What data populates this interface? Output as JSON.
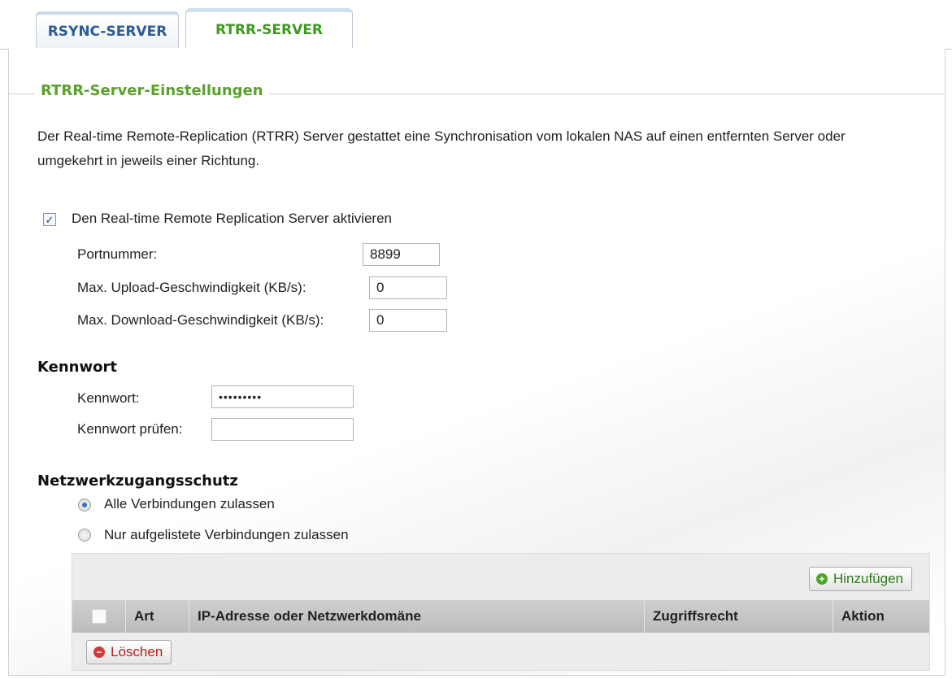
{
  "tabs": [
    {
      "label": "RSYNC-SERVER",
      "active": false
    },
    {
      "label": "RTRR-SERVER",
      "active": true
    }
  ],
  "legend": "RTRR-Server-Einstellungen",
  "description": "Der Real-time Remote-Replication (RTRR) Server gestattet eine Synchronisation vom lokalen NAS auf einen entfernten Server oder umgekehrt in jeweils einer Richtung.",
  "enable": {
    "label": "Den Real-time Remote Replication Server aktivieren",
    "checked": true
  },
  "settings": {
    "port_label": "Portnummer:",
    "port_value": "8899",
    "upload_label": "Max. Upload-Geschwindigkeit (KB/s):",
    "upload_value": "0",
    "download_label": "Max. Download-Geschwindigkeit (KB/s):",
    "download_value": "0"
  },
  "password": {
    "section_title": "Kennwort",
    "label": "Kennwort:",
    "value": "•••••••••",
    "confirm_label": "Kennwort prüfen:",
    "confirm_value": ""
  },
  "network": {
    "section_title": "Netzwerkzugangsschutz",
    "option_all": "Alle Verbindungen zulassen",
    "option_listed": "Nur aufgelistete Verbindungen zulassen",
    "selected": "all"
  },
  "table": {
    "add_label": "Hinzufügen",
    "delete_label": "Löschen",
    "columns": [
      "Art",
      "IP-Adresse oder Netzwerkdomäne",
      "Zugriffsrecht",
      "Aktion"
    ]
  },
  "colors": {
    "tab_active": "#3d9a1e",
    "tab_inactive": "#2c5c97",
    "legend": "#5aa02c"
  }
}
